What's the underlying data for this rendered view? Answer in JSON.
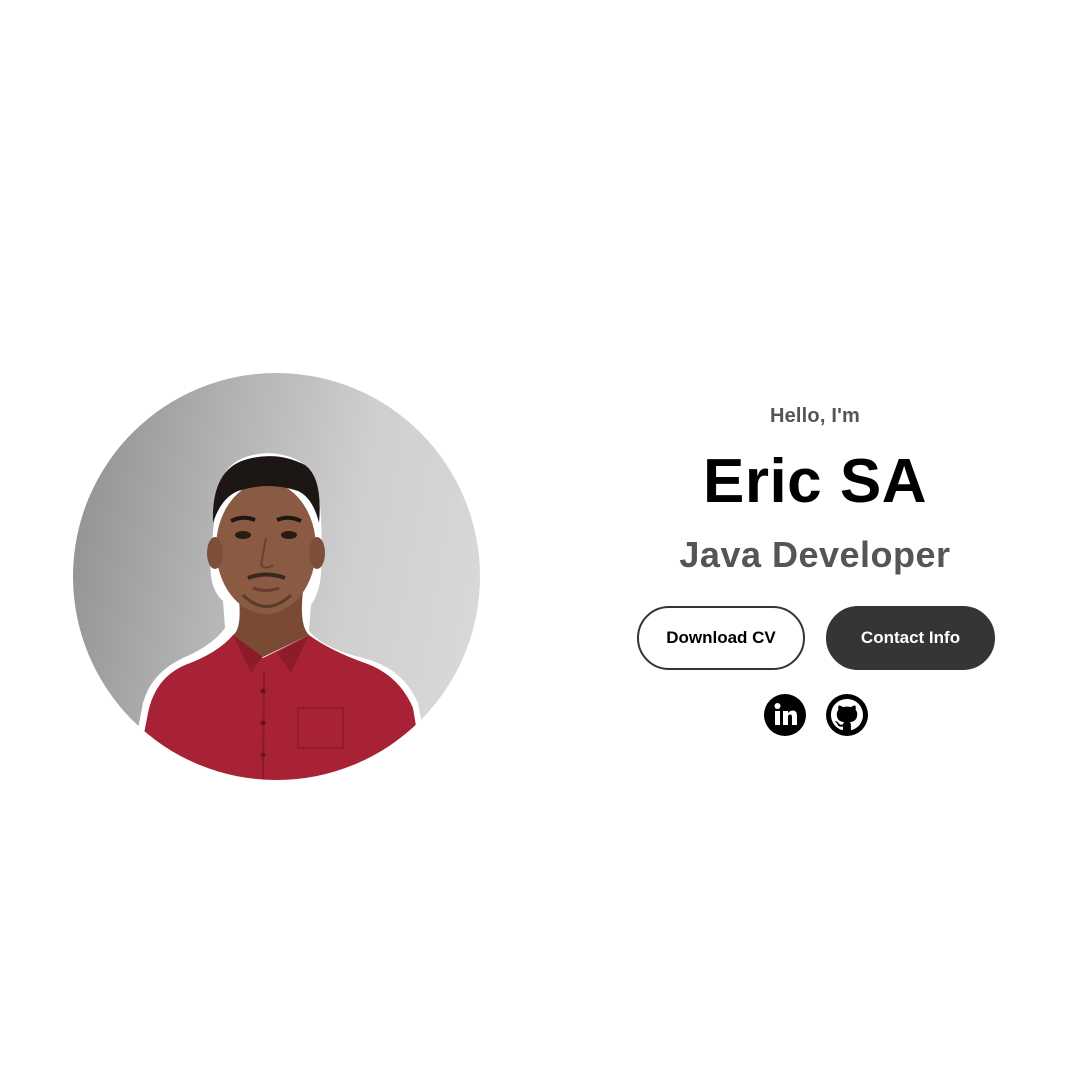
{
  "profile": {
    "photo_alt": "Profile picture"
  },
  "intro": {
    "greeting": "Hello, I'm",
    "name": "Eric SA",
    "role": "Java Developer"
  },
  "buttons": {
    "download_cv_label": "Download CV",
    "contact_info_label": "Contact Info"
  },
  "socials": [
    {
      "icon": "linkedin-icon",
      "label": "LinkedIn"
    },
    {
      "icon": "github-icon",
      "label": "GitHub"
    }
  ],
  "colors": {
    "text_primary": "#000000",
    "text_secondary": "#555555",
    "button_dark": "#353535",
    "shirt": "#a82235",
    "background": "#ffffff"
  }
}
